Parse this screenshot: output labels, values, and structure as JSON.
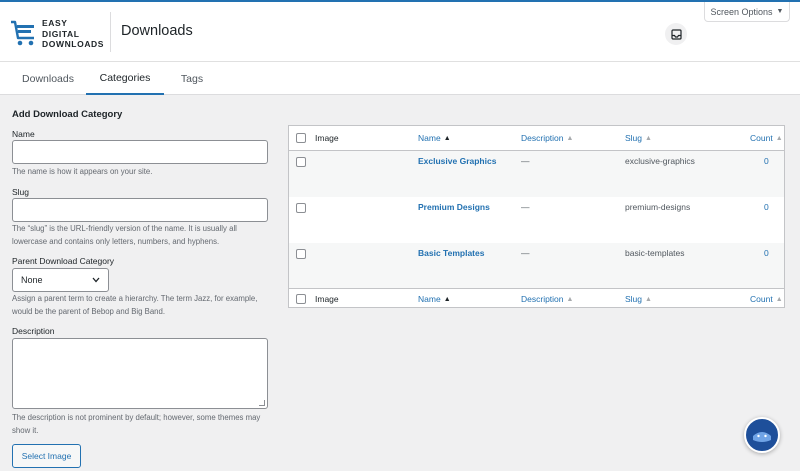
{
  "header": {
    "logo_lines": [
      "EASY",
      "DIGITAL",
      "DOWNLOADS"
    ],
    "page_title": "Downloads",
    "screen_options": "Screen Options"
  },
  "tabs": [
    {
      "label": "Downloads"
    },
    {
      "label": "Categories",
      "active": true
    },
    {
      "label": "Tags"
    }
  ],
  "form": {
    "title": "Add Download Category",
    "name_label": "Name",
    "name_hint": "The name is how it appears on your site.",
    "slug_label": "Slug",
    "slug_hint": "The “slug” is the URL-friendly version of the name. It is usually all lowercase and contains only letters, numbers, and hyphens.",
    "parent_label": "Parent Download Category",
    "parent_value": "None",
    "parent_hint": "Assign a parent term to create a hierarchy. The term Jazz, for example, would be the parent of Bebop and Big Band.",
    "description_label": "Description",
    "description_hint": "The description is not prominent by default; however, some themes may show it.",
    "select_image_label": "Select Image"
  },
  "table": {
    "columns": [
      "Image",
      "Name",
      "Description",
      "Slug",
      "Count"
    ],
    "rows": [
      {
        "name": "Exclusive Graphics",
        "description": "—",
        "slug": "exclusive-graphics",
        "count": "0"
      },
      {
        "name": "Premium Designs",
        "description": "—",
        "slug": "premium-designs",
        "count": "0"
      },
      {
        "name": "Basic Templates",
        "description": "—",
        "slug": "basic-templates",
        "count": "0"
      }
    ]
  },
  "icons": {
    "logo": "edd-cart-logo-icon",
    "inbox": "inbox-icon",
    "screen_options_caret": "caret-down-icon",
    "help": "help-chat-icon",
    "sort": "sort-arrows-icon"
  },
  "colors": {
    "accent": "#2271b1",
    "background": "#f0f0f1",
    "help_bubble": "#1e4f9a"
  }
}
